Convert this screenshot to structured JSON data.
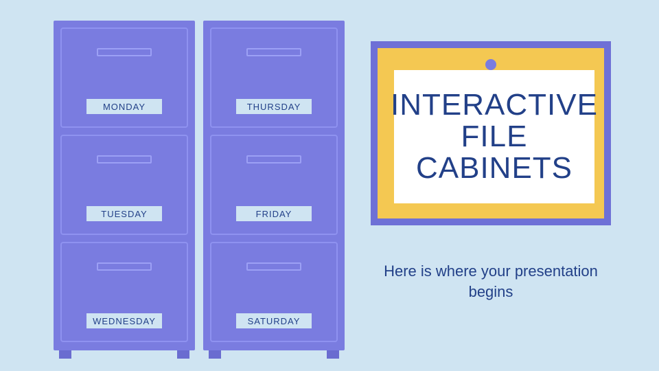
{
  "cabinets": {
    "left": {
      "drawers": [
        "MONDAY",
        "TUESDAY",
        "WEDNESDAY"
      ]
    },
    "right": {
      "drawers": [
        "THURSDAY",
        "FRIDAY",
        "SATURDAY"
      ]
    }
  },
  "board": {
    "title_line1": "INTERACTIVE",
    "title_line2": "FILE CABINETS"
  },
  "subtitle": "Here is where your presentation begins"
}
